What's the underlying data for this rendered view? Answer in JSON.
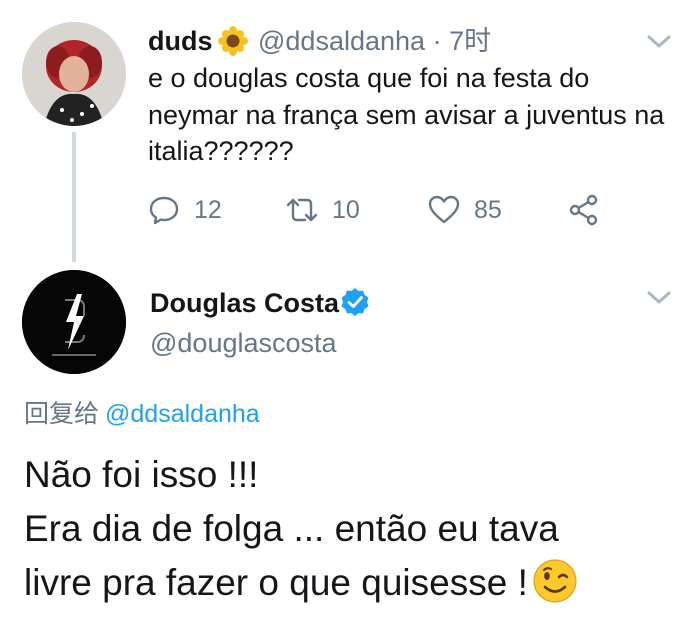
{
  "original_tweet": {
    "author_name": "duds",
    "author_emoji": "sunflower-emoji",
    "handle": "@ddsaldanha",
    "separator": "·",
    "time": "7时",
    "text": "e o douglas costa que foi na festa do neymar na frança sem avisar a juventus na italia??????",
    "actions": {
      "reply_count": "12",
      "retweet_count": "10",
      "like_count": "85"
    }
  },
  "reply_tweet": {
    "author_name": "Douglas Costa",
    "verified_icon": "verified-badge-icon",
    "handle": "@douglascosta",
    "replying_label": "回复给",
    "replying_to": "@ddsaldanha",
    "lines": [
      "Não foi isso !!!",
      "Era dia de folga ... então eu tava",
      "livre pra fazer o que quisesse !"
    ],
    "trailing_emoji": "winking-face-emoji"
  },
  "colors": {
    "text": "#14171a",
    "muted": "#657786",
    "accent": "#1da1f2",
    "thread_line": "#cfd9de"
  }
}
